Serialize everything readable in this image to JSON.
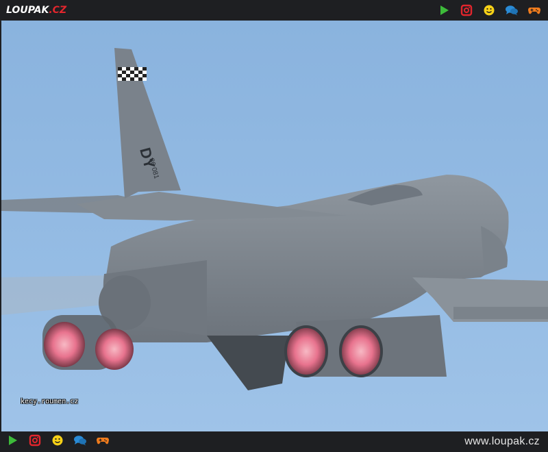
{
  "header": {
    "logo_text": "LOUPAK",
    "logo_tld": ".CZ",
    "icons": [
      "play-icon",
      "instagram-icon",
      "smiley-icon",
      "chat-icon",
      "gamepad-icon"
    ]
  },
  "photo": {
    "watermark": "kecy.roumen.cz",
    "tail_code": "DY",
    "tail_serial": "86 081"
  },
  "footer": {
    "site_label": "www.loupak.cz",
    "icons": [
      "play-icon",
      "instagram-icon",
      "smiley-icon",
      "chat-icon",
      "gamepad-icon"
    ]
  },
  "colors": {
    "bar_bg": "#1e1f22",
    "sky": "#94bbe3",
    "aircraft_gray": "#7f8790",
    "afterburner": "#e8738e",
    "play": "#3dbb3a",
    "instagram": "#e3262d",
    "smiley": "#f7d117",
    "chat": "#2a8bd6",
    "gamepad": "#f07c1d"
  }
}
